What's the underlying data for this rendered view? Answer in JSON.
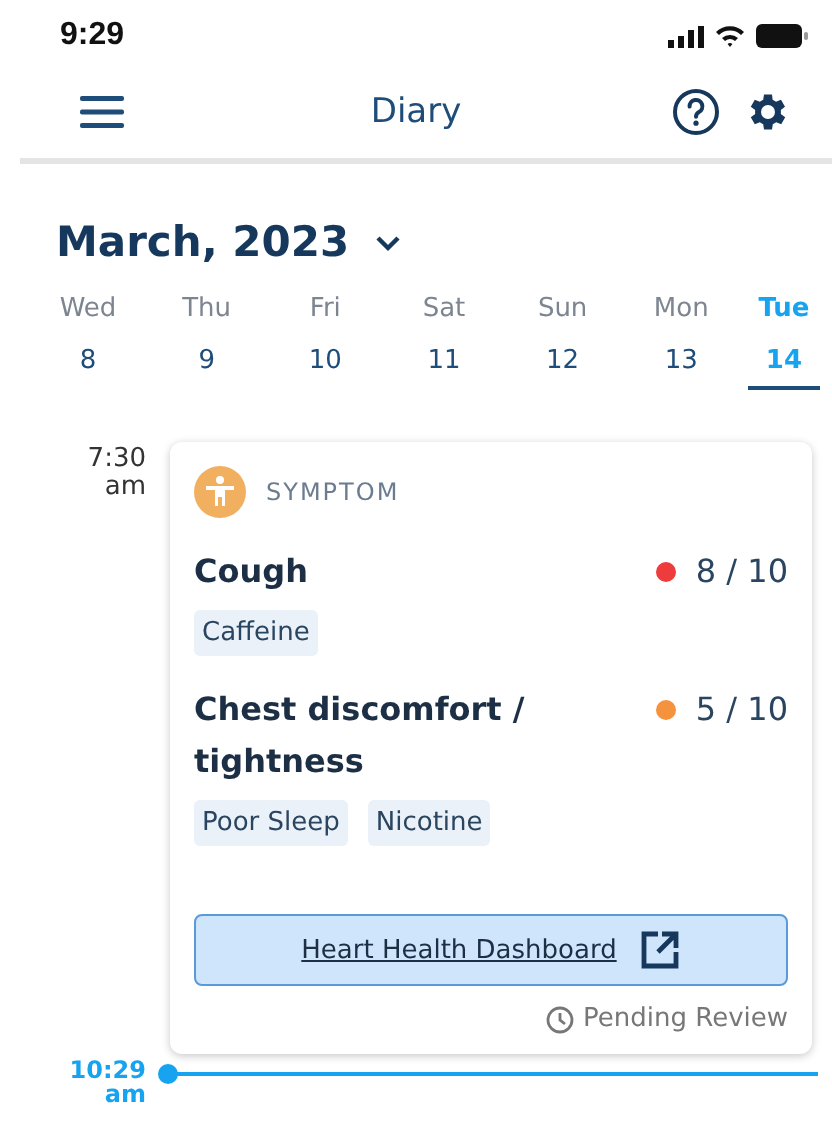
{
  "status_bar": {
    "time": "9:29"
  },
  "header": {
    "title": "Diary"
  },
  "month": {
    "label": "March, 2023"
  },
  "days": [
    {
      "weekday": "Wed",
      "date": "8",
      "selected": false
    },
    {
      "weekday": "Thu",
      "date": "9",
      "selected": false
    },
    {
      "weekday": "Fri",
      "date": "10",
      "selected": false
    },
    {
      "weekday": "Sat",
      "date": "11",
      "selected": false
    },
    {
      "weekday": "Sun",
      "date": "12",
      "selected": false
    },
    {
      "weekday": "Mon",
      "date": "13",
      "selected": false
    },
    {
      "weekday": "Tue",
      "date": "14",
      "selected": true
    }
  ],
  "entry": {
    "time": "7:30",
    "period": "am",
    "category": "SYMPTOM",
    "symptoms": [
      {
        "name": "Chest discomfort / tightness",
        "score": "5 / 10",
        "color": "#f5923e",
        "tags": [
          "Poor Sleep",
          "Nicotine"
        ]
      }
    ],
    "first_symptom": {
      "name": "Cough",
      "score": "8 / 10",
      "color": "#ee3b3b",
      "tags": [
        "Caffeine"
      ]
    },
    "link": "Heart Health Dashboard",
    "status": "Pending Review"
  },
  "now": {
    "time": "10:29",
    "period": "am"
  }
}
